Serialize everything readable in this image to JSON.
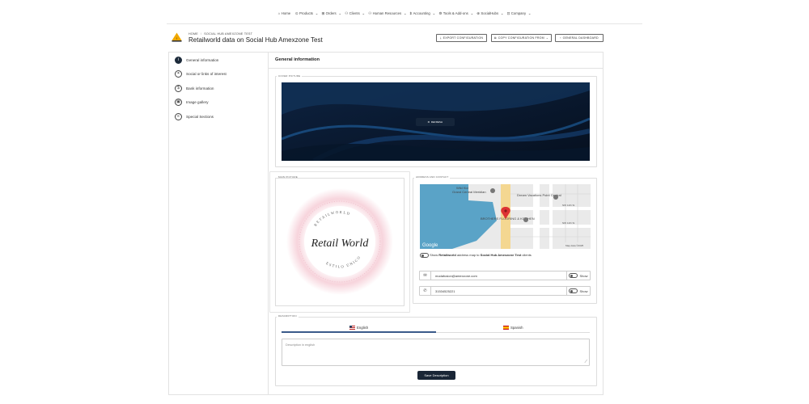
{
  "nav": {
    "items": [
      "Home",
      "Products",
      "Orders",
      "Clients",
      "Human Resources",
      "Accounting",
      "Tools & Add-ons",
      "SocialHubs",
      "Company"
    ],
    "icons": [
      "home-icon",
      "box-icon",
      "orders-icon",
      "users-icon",
      "hr-icon",
      "dollar-icon",
      "tools-icon",
      "social-icon",
      "building-icon"
    ]
  },
  "header": {
    "breadcrumb": [
      "HOME",
      "SOCIAL HUB AMEXZONE TEST"
    ],
    "title": "Retailworld data on Social Hub Amexzone Test",
    "buttons": {
      "export": "EXPORT CONFIGURATION",
      "copy": "COPY CONFIGURATION FROM",
      "dashboard": "GENERAL DASHBOARD"
    }
  },
  "sidebar": {
    "items": [
      {
        "label": "General information",
        "icon": "info-icon",
        "glyph": "i"
      },
      {
        "label": "Social or links of interest",
        "icon": "link-icon",
        "glyph": "⚭"
      },
      {
        "label": "Bank information",
        "icon": "bank-icon",
        "glyph": "$"
      },
      {
        "label": "Image gallery",
        "icon": "gallery-icon",
        "glyph": "▣"
      },
      {
        "label": "Special Sections",
        "icon": "list-icon",
        "glyph": "≡"
      }
    ]
  },
  "main": {
    "heading": "General information",
    "cover": {
      "legend": "COVER PICTURE",
      "refresh_label": "REFRESH"
    },
    "main_picture": {
      "legend": "MAIN PICTURE",
      "logo_text": "Retail World",
      "ring_top": "RETAILWORLD",
      "ring_bottom": "ESTILO ÚNICO"
    },
    "address": {
      "legend": "ADDRESS AND CONTACT",
      "map_labels": {
        "place1": "Wild Kid",
        "place2": "Grand Central Meridian",
        "place3": "Dream Vacations Point Central",
        "place4": "BROTHERS FLOORING & KITCHEN",
        "street1": "NW 14th St",
        "street2": "NW 14th St",
        "google": "Google",
        "mapdata": "Map data ©2025"
      },
      "show_map_prefix": "Show",
      "show_map_store": "Retailworld",
      "show_map_middle": "address map to",
      "show_map_hub": "Social Hub Amexzone Test",
      "show_map_suffix": "clients",
      "email": "modafusion@amexzone.com",
      "phone": "31534525221",
      "show_label": "Show"
    },
    "description": {
      "legend": "DESCRIPTION",
      "tabs": [
        {
          "label": "English",
          "flag": "us-flag"
        },
        {
          "label": "Spanish",
          "flag": "es-flag"
        }
      ],
      "placeholder": "Description in english",
      "save_label": "Save Description"
    }
  },
  "colors": {
    "accent": "#1a2636",
    "cover": "#0b1a30",
    "tab_active": "#3a5a8a",
    "pin": "#d33",
    "water": "#5aa3c7"
  }
}
